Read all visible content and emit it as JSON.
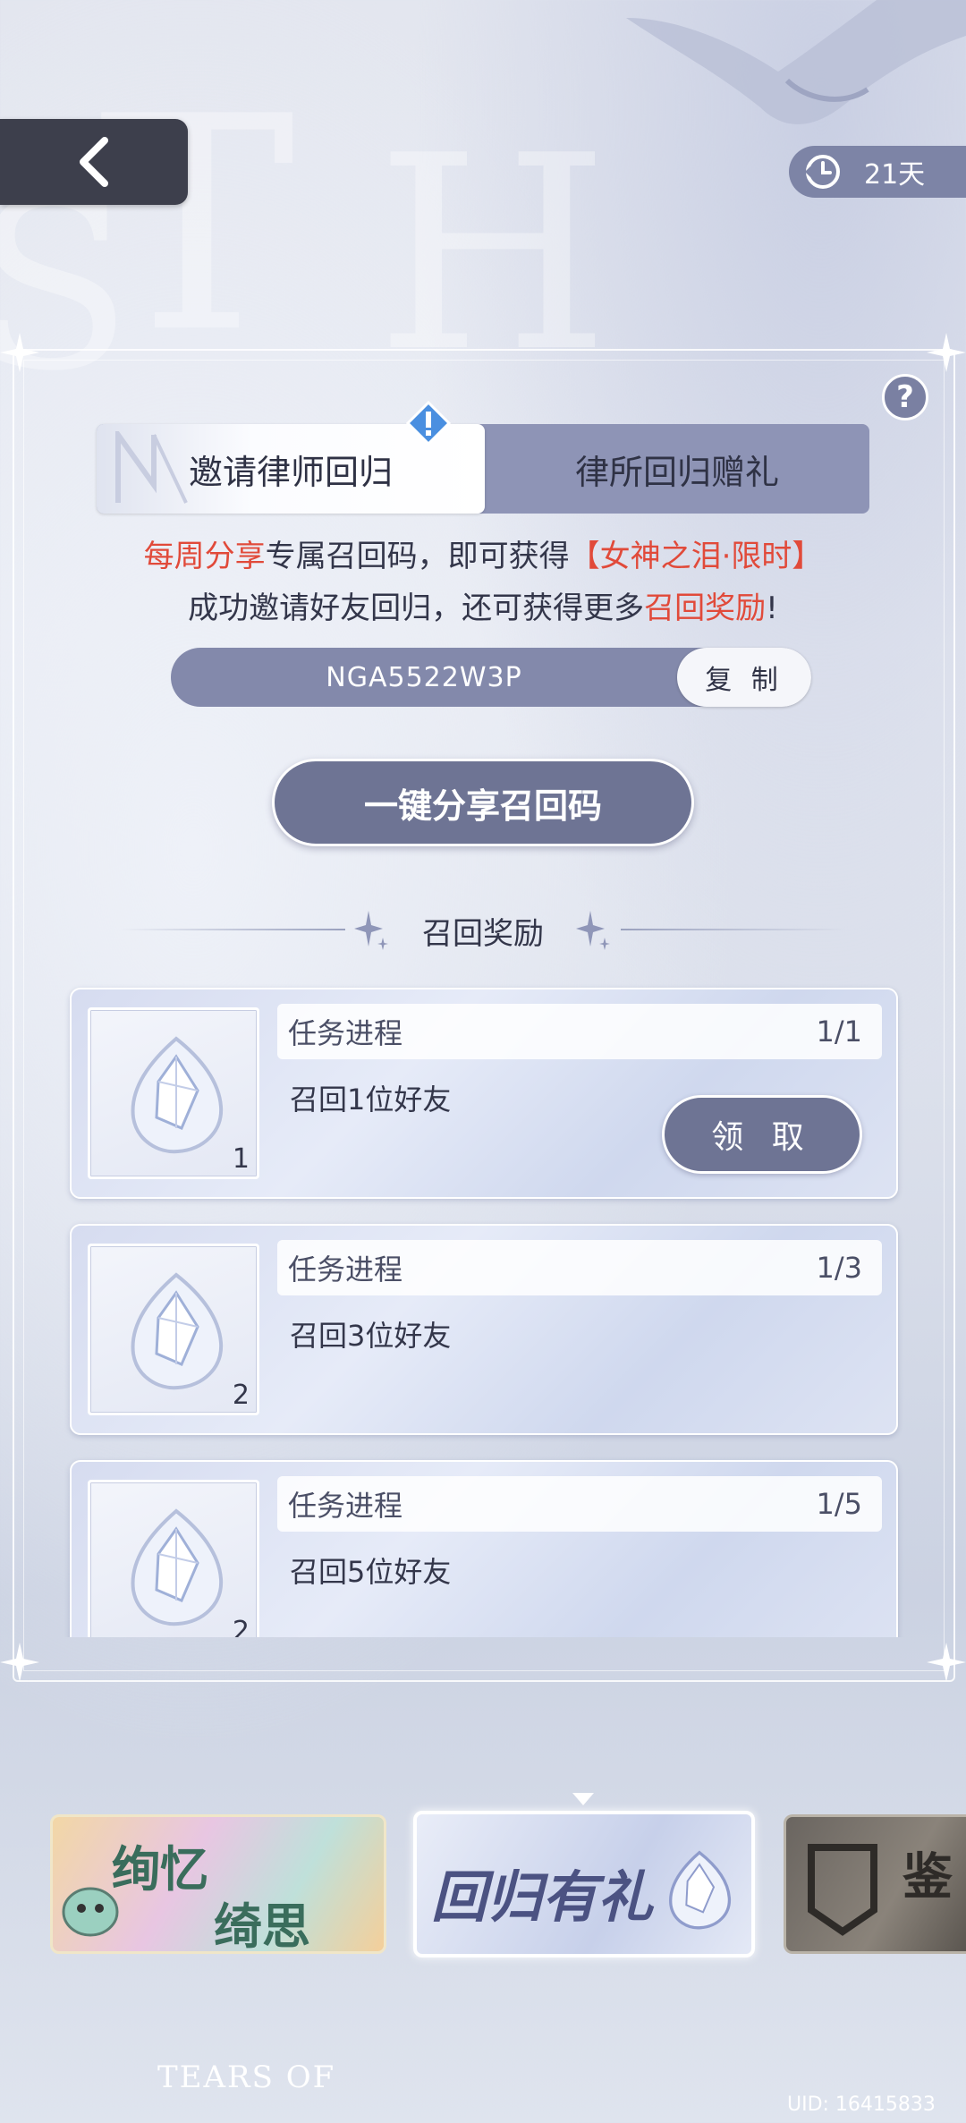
{
  "header": {
    "days_left": "21天"
  },
  "tabs": [
    {
      "label": "邀请律师回归",
      "active": true
    },
    {
      "label": "律所回归赠礼",
      "active": false
    }
  ],
  "info": {
    "line1_part1": "每周分享",
    "line1_part2": "专属召回码，即可获得",
    "line1_part3": "【女神之泪·限时】",
    "line2_part1": "成功邀请好友回归，还可获得更多",
    "line2_part2": "召回奖励",
    "line2_part3": "!"
  },
  "recall_code": {
    "code": "NGA5522W3P",
    "copy_label": "复 制"
  },
  "share_button": "一键分享召回码",
  "rewards_section": {
    "title": "召回奖励",
    "items": [
      {
        "progress_label": "任务进程",
        "progress": "1/1",
        "task": "召回1位好友",
        "quantity": "1",
        "claim_label": "领 取"
      },
      {
        "progress_label": "任务进程",
        "progress": "1/3",
        "task": "召回3位好友",
        "quantity": "2"
      },
      {
        "progress_label": "任务进程",
        "progress": "1/5",
        "task": "召回5位好友",
        "quantity": "2"
      }
    ]
  },
  "banners": [
    {
      "text_a": "绚忆",
      "text_b": "绮思"
    },
    {
      "text": "回归有礼"
    },
    {
      "text": "鉴"
    }
  ],
  "footer": {
    "logo_line": "TEARS OF",
    "uid": "UID: 16415833"
  },
  "colors": {
    "accent": "#6e7494",
    "highlight_red": "#e14a3a",
    "tab_bar": "#8e94b6"
  }
}
